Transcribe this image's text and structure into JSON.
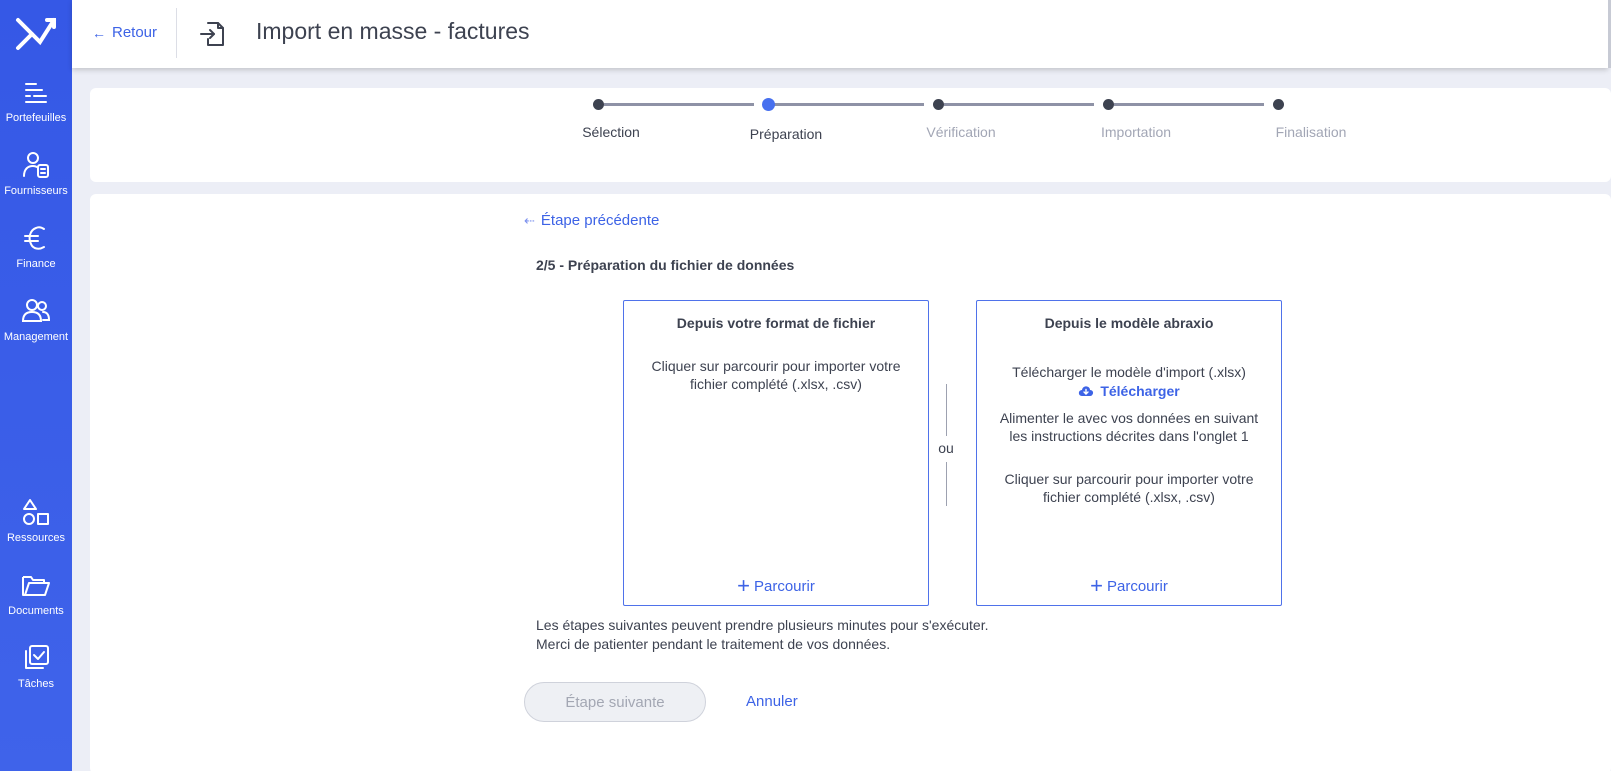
{
  "sidebar": {
    "items": [
      {
        "label": "Portefeuilles",
        "icon": "portfolio-icon"
      },
      {
        "label": "Fournisseurs",
        "icon": "supplier-icon"
      },
      {
        "label": "Finance",
        "icon": "euro-icon"
      },
      {
        "label": "Management",
        "icon": "users-icon"
      },
      {
        "label": "Ressources",
        "icon": "shapes-icon"
      },
      {
        "label": "Documents",
        "icon": "folder-icon"
      },
      {
        "label": "Tâches",
        "icon": "tasks-icon"
      }
    ]
  },
  "header": {
    "back_label": "Retour",
    "title": "Import en masse - factures"
  },
  "stepper": {
    "steps": [
      {
        "label": "Sélection",
        "state": "done"
      },
      {
        "label": "Préparation",
        "state": "active"
      },
      {
        "label": "Vérification",
        "state": "todo"
      },
      {
        "label": "Importation",
        "state": "todo"
      },
      {
        "label": "Finalisation",
        "state": "todo"
      }
    ]
  },
  "main": {
    "prev_step_label": "Étape précédente",
    "section_title": "2/5 - Préparation du fichier de données",
    "left_box": {
      "title": "Depuis votre format de fichier",
      "text": "Cliquer sur parcourir pour importer votre fichier complété (.xlsx, .csv)",
      "browse_label": "Parcourir"
    },
    "or_label": "ou",
    "right_box": {
      "title": "Depuis le modèle abraxio",
      "download_text": "Télécharger le modèle d'import (.xlsx)",
      "download_label": "Télécharger",
      "fill_text": "Alimenter le avec vos données en suivant les instructions décrites dans l'onglet 1",
      "import_text": "Cliquer sur parcourir pour importer votre fichier complété (.xlsx, .csv)",
      "browse_label": "Parcourir"
    },
    "note_line1": "Les étapes suivantes peuvent prendre plusieurs minutes pour s'exécuter.",
    "note_line2": "Merci de patienter pendant le traitement de vos données.",
    "next_label": "Étape suivante",
    "cancel_label": "Annuler"
  },
  "colors": {
    "sidebar": "#3558e6",
    "accent": "#4770ef",
    "link": "#3d63e6",
    "text": "#3d4250",
    "muted": "#a2a6b5"
  }
}
